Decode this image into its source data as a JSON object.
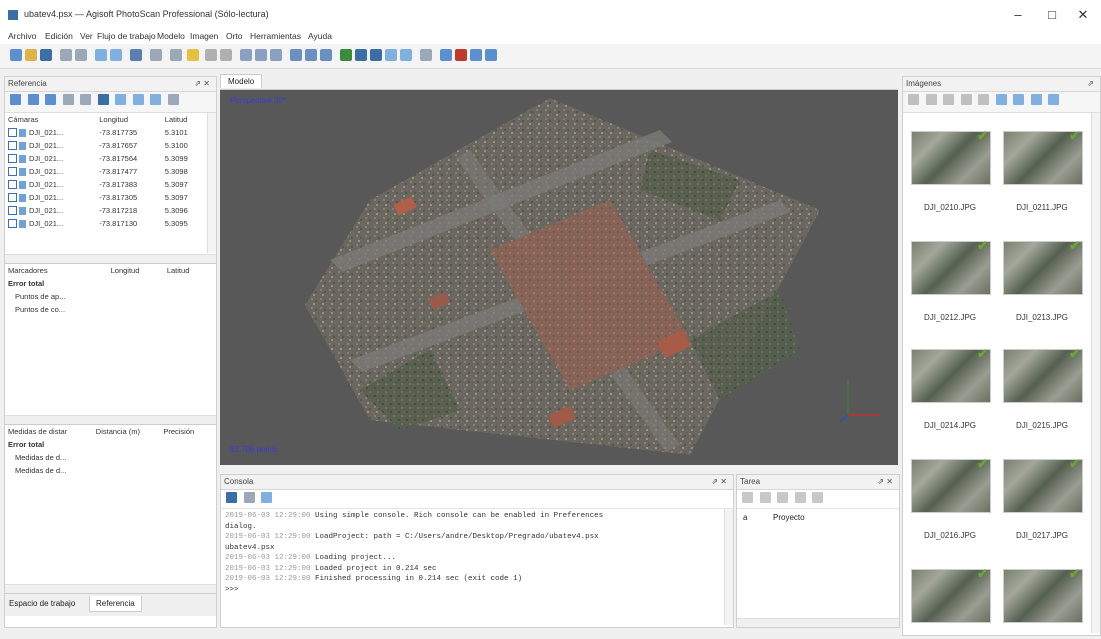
{
  "window": {
    "title": "ubatev4.psx — Agisoft PhotoScan Professional (Sólo-lectura)",
    "minimize": "–",
    "maximize": "□",
    "close": "✕"
  },
  "menu": [
    "Archivo",
    "Edición",
    "Ver",
    "Flujo de trabajo",
    "Modelo",
    "Imagen",
    "Orto",
    "Herramientas",
    "Ayuda"
  ],
  "reference": {
    "title": "Referencia",
    "cameras_headers": [
      "Cámaras",
      "Longitud",
      "Latitud"
    ],
    "cameras": [
      {
        "name": "DJI_021...",
        "lon": "-73.817735",
        "lat": "5.3101"
      },
      {
        "name": "DJI_021...",
        "lon": "-73.817657",
        "lat": "5.3100"
      },
      {
        "name": "DJI_021...",
        "lon": "-73.817564",
        "lat": "5.3099"
      },
      {
        "name": "DJI_021...",
        "lon": "-73.817477",
        "lat": "5.3098"
      },
      {
        "name": "DJI_021...",
        "lon": "-73.817383",
        "lat": "5.3097"
      },
      {
        "name": "DJI_021...",
        "lon": "-73.817305",
        "lat": "5.3097"
      },
      {
        "name": "DJI_021...",
        "lon": "-73.817218",
        "lat": "5.3096"
      },
      {
        "name": "DJI_021...",
        "lon": "-73.817130",
        "lat": "5.3095"
      }
    ],
    "markers_headers": [
      "Marcadores",
      "Longitud",
      "Latitud"
    ],
    "markers_group": "Error total",
    "markers": [
      "Puntos de ap...",
      "Puntos de co..."
    ],
    "scalebars_headers": [
      "Medidas de distar",
      "Distancia (m)",
      "Precisión"
    ],
    "scalebars_group": "Error total",
    "scalebars": [
      "Medidas de d...",
      "Medidas de d..."
    ]
  },
  "bottom_tabs": [
    "Espacio de trabajo",
    "Referencia"
  ],
  "model": {
    "tab": "Modelo",
    "perspective": "Perspective 30°",
    "points": "82,709 points"
  },
  "console": {
    "title": "Consola",
    "lines": [
      {
        "ts": "2019-06-03 12:29:00",
        "msg": "Using simple console. Rich console can be enabled in Preferences"
      },
      {
        "ts": "",
        "msg": "dialog."
      },
      {
        "ts": "2019-06-03 12:29:00",
        "msg": "LoadProject: path = C:/Users/andre/Desktop/Pregrado/ubatev4.psx"
      },
      {
        "ts": "",
        "msg": "ubatev4.psx"
      },
      {
        "ts": "2019-06-03 12:29:00",
        "msg": "Loading project..."
      },
      {
        "ts": "2019-06-03 12:29:00",
        "msg": "Loaded project in 0.214 sec"
      },
      {
        "ts": "2019-06-03 12:29:00",
        "msg": "Finished processing in 0.214 sec (exit code 1)"
      },
      {
        "ts": "",
        "msg": ">>>"
      }
    ]
  },
  "tasks": {
    "title": "Tarea",
    "row_marker": "a",
    "row_label": "Proyecto"
  },
  "images": {
    "title": "Imágenes",
    "thumbs": [
      "DJI_0210.JPG",
      "DJI_0211.JPG",
      "DJI_0212.JPG",
      "DJI_0213.JPG",
      "DJI_0214.JPG",
      "DJI_0215.JPG",
      "DJI_0216.JPG",
      "DJI_0217.JPG",
      "",
      ""
    ]
  },
  "colors": {
    "accent": "#3b6fb6",
    "viewport_bg": "#585858",
    "check": "#6aa832"
  }
}
